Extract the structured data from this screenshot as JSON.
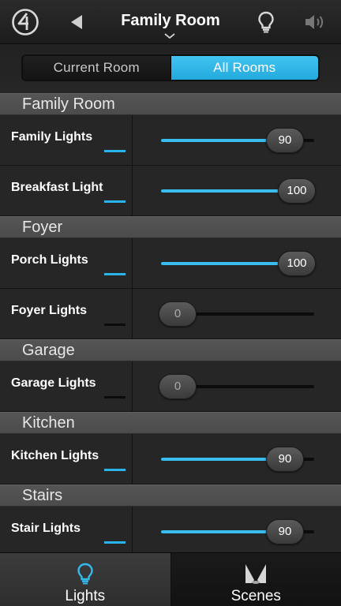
{
  "header": {
    "title": "Family Room"
  },
  "segment": {
    "current_label": "Current Room",
    "all_label": "All Rooms",
    "selected": "All Rooms"
  },
  "colors": {
    "accent": "#29b3e8",
    "background": "#262626",
    "section_header": "#4e4e4e"
  },
  "sections": [
    {
      "title": "Family Room",
      "rows": [
        {
          "label": "Family Lights",
          "level": 90,
          "level_text": "90",
          "on": true
        },
        {
          "label": "Breakfast Light",
          "level": 100,
          "level_text": "100",
          "on": true
        }
      ]
    },
    {
      "title": "Foyer",
      "rows": [
        {
          "label": "Porch Lights",
          "level": 100,
          "level_text": "100",
          "on": true
        },
        {
          "label": "Foyer Lights",
          "level": 0,
          "level_text": "0",
          "on": false
        }
      ]
    },
    {
      "title": "Garage",
      "rows": [
        {
          "label": "Garage Lights",
          "level": 0,
          "level_text": "0",
          "on": false
        }
      ]
    },
    {
      "title": "Kitchen",
      "rows": [
        {
          "label": "Kitchen Lights",
          "level": 90,
          "level_text": "90",
          "on": true
        }
      ]
    },
    {
      "title": "Stairs",
      "rows": [
        {
          "label": "Stair Lights",
          "level": 90,
          "level_text": "90",
          "on": true
        }
      ]
    }
  ],
  "tabs": [
    {
      "label": "Lights",
      "icon": "lightbulb-icon",
      "selected": true
    },
    {
      "label": "Scenes",
      "icon": "scenes-icon",
      "selected": false
    }
  ]
}
